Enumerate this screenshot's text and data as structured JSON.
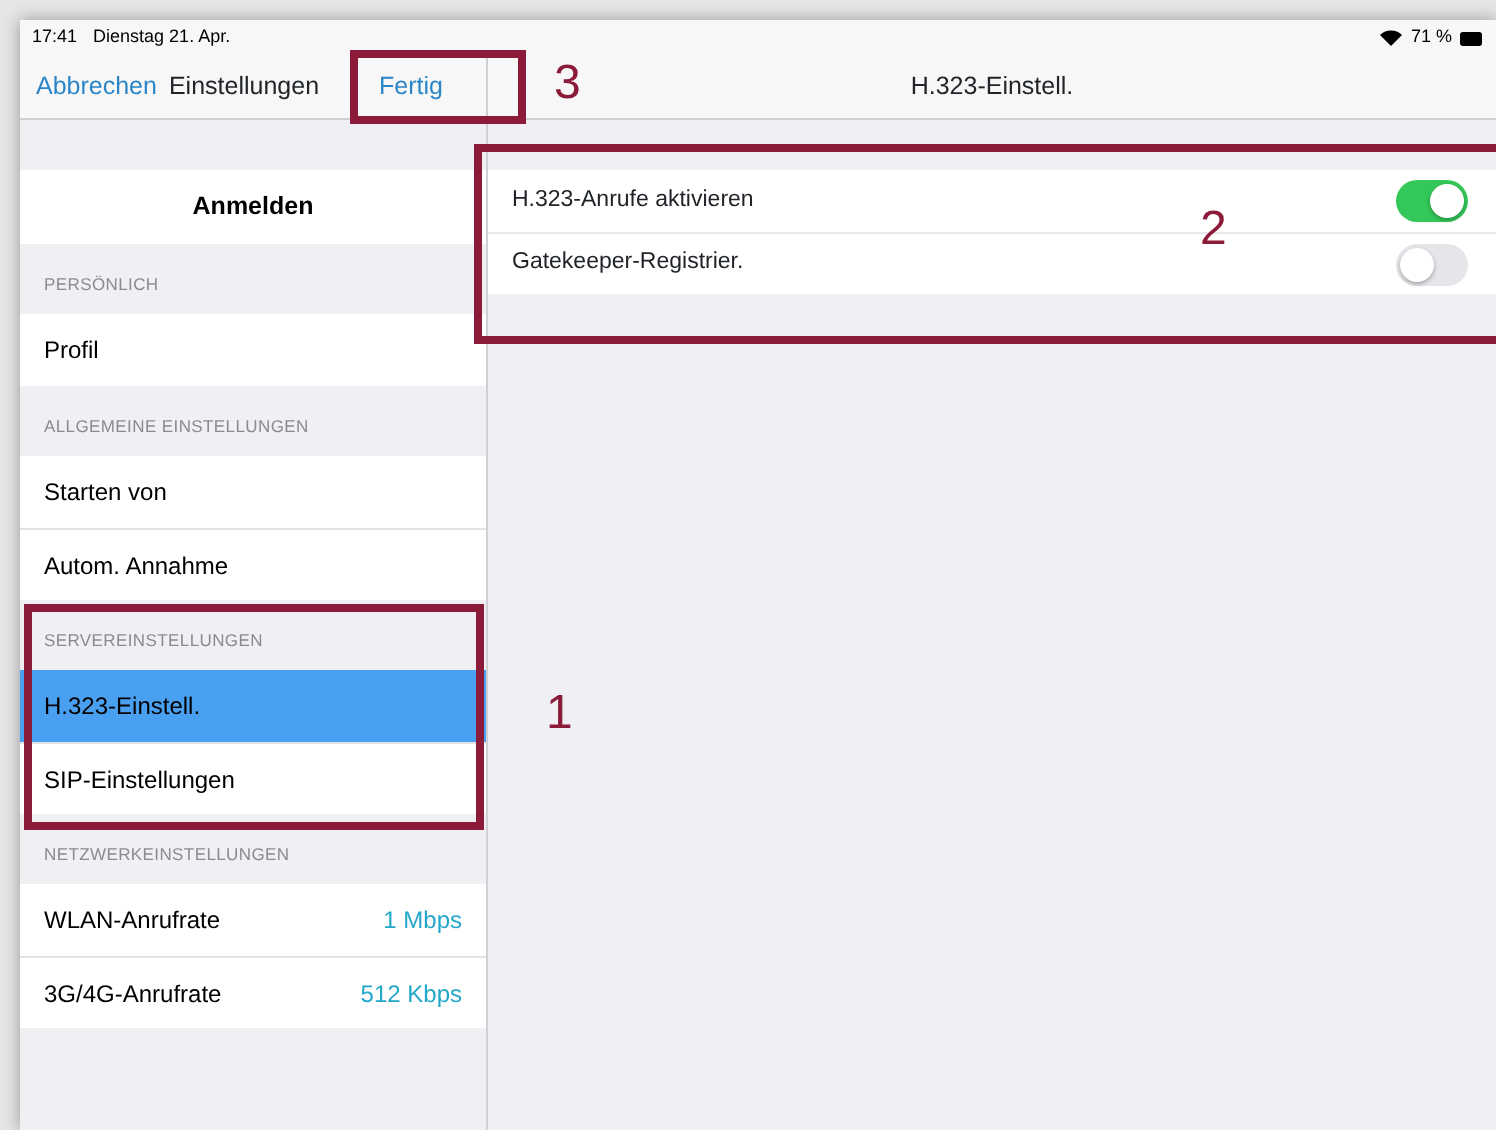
{
  "status_bar": {
    "time": "17:41",
    "date": "Dienstag 21. Apr.",
    "battery": "71 %"
  },
  "nav_bar": {
    "cancel": "Abbrechen",
    "title": "Einstellungen",
    "done": "Fertig",
    "detail_title": "H.323-Einstell."
  },
  "sidebar": {
    "top_item": "Anmelden",
    "sections": [
      {
        "header": "PERSÖNLICH",
        "items": [
          {
            "label": "Profil",
            "selected": false
          }
        ]
      },
      {
        "header": "ALLGEMEINE EINSTELLUNGEN",
        "items": [
          {
            "label": "Starten von",
            "selected": false
          },
          {
            "label": "Autom. Annahme",
            "selected": false
          }
        ]
      },
      {
        "header": "SERVEREINSTELLUNGEN",
        "items": [
          {
            "label": "H.323-Einstell.",
            "selected": true
          },
          {
            "label": "SIP-Einstellungen",
            "selected": false
          }
        ]
      },
      {
        "header": "NETZWERKEINSTELLUNGEN",
        "items": [
          {
            "label": "WLAN-Anrufrate",
            "value": "1 Mbps",
            "selected": false
          },
          {
            "label": "3G/4G-Anrufrate",
            "value": "512 Kbps",
            "selected": false
          }
        ]
      }
    ]
  },
  "detail": {
    "rows": [
      {
        "label": "H.323-Anrufe aktivieren",
        "on": true
      },
      {
        "label": "Gatekeeper-Registrier.",
        "on": false
      }
    ]
  },
  "callouts": [
    {
      "number": "3",
      "kind": "done"
    },
    {
      "number": "2",
      "kind": "detail"
    },
    {
      "number": "1",
      "kind": "section"
    }
  ]
}
